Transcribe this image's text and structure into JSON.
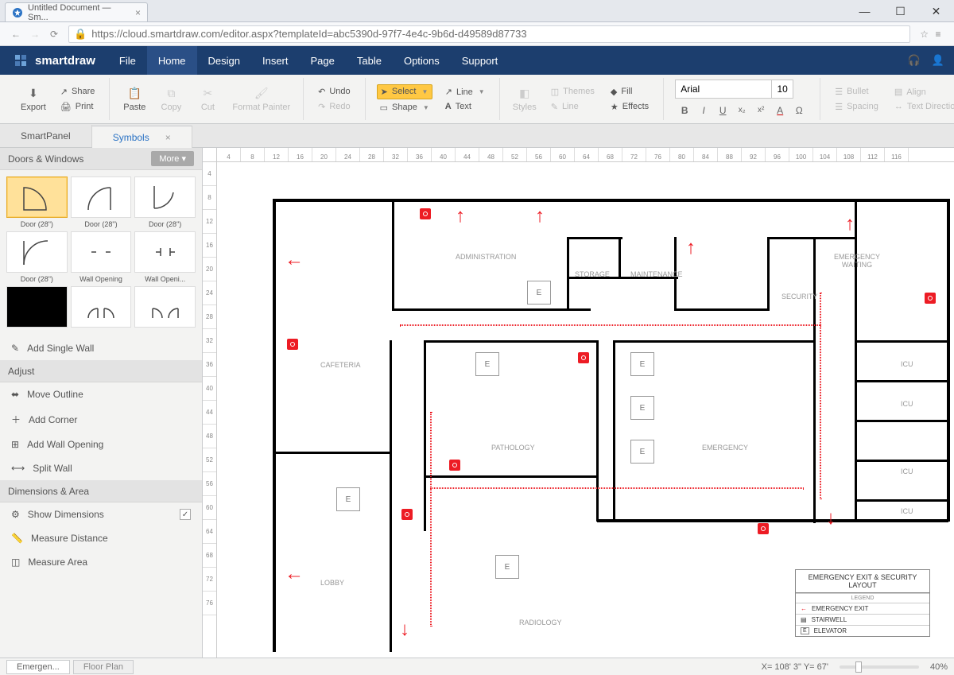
{
  "browser": {
    "tab_title": "Untitled Document — Sm...",
    "url": "https://cloud.smartdraw.com/editor.aspx?templateId=abc5390d-97f7-4e4c-9b6d-d49589d87733"
  },
  "app": {
    "brand": "smartdraw",
    "menu": [
      "File",
      "Home",
      "Design",
      "Insert",
      "Page",
      "Table",
      "Options",
      "Support"
    ],
    "active_menu_index": 1
  },
  "ribbon": {
    "export": "Export",
    "share": "Share",
    "print": "Print",
    "paste": "Paste",
    "copy": "Copy",
    "cut": "Cut",
    "format_painter": "Format Painter",
    "undo": "Undo",
    "redo": "Redo",
    "select": "Select",
    "shape": "Shape",
    "line": "Line",
    "text": "Text",
    "styles": "Styles",
    "themes": "Themes",
    "line2": "Line",
    "fill": "Fill",
    "effects": "Effects",
    "font_name": "Arial",
    "font_size": "10",
    "bullet": "Bullet",
    "align": "Align",
    "spacing": "Spacing",
    "text_direction": "Text Direction"
  },
  "panel_tabs": {
    "smartpanel": "SmartPanel",
    "symbols": "Symbols"
  },
  "sidebar": {
    "doors_title": "Doors & Windows",
    "more": "More",
    "symbols": [
      {
        "label": "Door (28\")"
      },
      {
        "label": "Door (28\")"
      },
      {
        "label": "Door (28\")"
      },
      {
        "label": "Door (28\")"
      },
      {
        "label": "Wall Opening"
      },
      {
        "label": "Wall Openi..."
      },
      {
        "label": ""
      },
      {
        "label": ""
      },
      {
        "label": ""
      }
    ],
    "add_single_wall": "Add Single Wall",
    "adjust_title": "Adjust",
    "adjust_items": [
      "Move Outline",
      "Add Corner",
      "Add Wall Opening",
      "Split Wall"
    ],
    "dims_title": "Dimensions & Area",
    "show_dimensions": "Show Dimensions",
    "measure_distance": "Measure Distance",
    "measure_area": "Measure Area"
  },
  "plan": {
    "rooms": {
      "administration": "ADMINISTRATION",
      "storage": "STORAGE",
      "maintenance": "MAINTENANCE",
      "security": "SECURITY",
      "emergency_waiting": "EMERGENCY WAITING",
      "cafeteria": "CAFETERIA",
      "pathology": "PATHOLOGY",
      "emergency": "EMERGENCY",
      "icu": "ICU",
      "lobby": "LOBBY",
      "radiology": "RADIOLOGY"
    },
    "elevator": "E",
    "legend": {
      "title": "EMERGENCY EXIT & SECURITY LAYOUT",
      "legend_label": "LEGEND",
      "emergency_exit": "EMERGENCY EXIT",
      "stairwell": "STAIRWELL",
      "elevator": "ELEVATOR"
    }
  },
  "ruler_h": [
    "4",
    "8",
    "12",
    "16",
    "20",
    "24",
    "28",
    "32",
    "36",
    "40",
    "44",
    "48",
    "52",
    "56",
    "60",
    "64",
    "68",
    "72",
    "76",
    "80",
    "84",
    "88",
    "92",
    "96",
    "100",
    "104",
    "108",
    "112",
    "116"
  ],
  "ruler_v": [
    "4",
    "8",
    "12",
    "16",
    "20",
    "24",
    "28",
    "32",
    "36",
    "40",
    "44",
    "48",
    "52",
    "56",
    "60",
    "64",
    "68",
    "72",
    "76"
  ],
  "status": {
    "sheet_active": "Emergen...",
    "sheet_other": "Floor Plan",
    "coords": "X= 108' 3\" Y= 67'",
    "zoom": "40%"
  }
}
